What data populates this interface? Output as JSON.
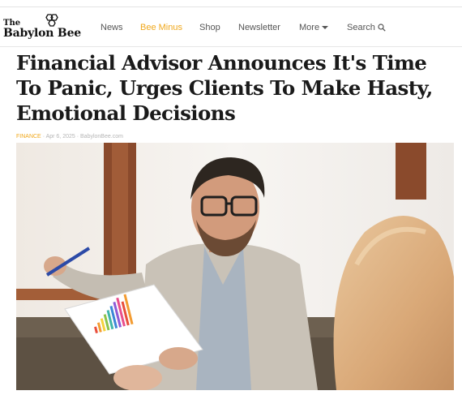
{
  "site": {
    "logo_small": "The",
    "logo_name": "Babylon Bee"
  },
  "nav": {
    "items": [
      {
        "label": "News"
      },
      {
        "label": "Bee Minus"
      },
      {
        "label": "Shop"
      },
      {
        "label": "Newsletter"
      },
      {
        "label": "More"
      },
      {
        "label": "Search"
      }
    ]
  },
  "article": {
    "headline": "Financial Advisor Announces It's Time To Panic, Urges Clients To Make Hasty, Emotional Decisions",
    "category": "FINANCE",
    "date": "Apr 6, 2025",
    "source": "BabylonBee.com"
  },
  "colors": {
    "accent": "#f0a81c",
    "text": "#1a1a1a",
    "nav_text": "#555555"
  },
  "icons": [
    "bee-logo-icon",
    "chevron-down-icon",
    "search-icon"
  ],
  "hero_image": {
    "type": "photo",
    "semantic": "advisor-with-glasses-holding-pen-and-bar-chart-talking-to-blonde-client"
  }
}
